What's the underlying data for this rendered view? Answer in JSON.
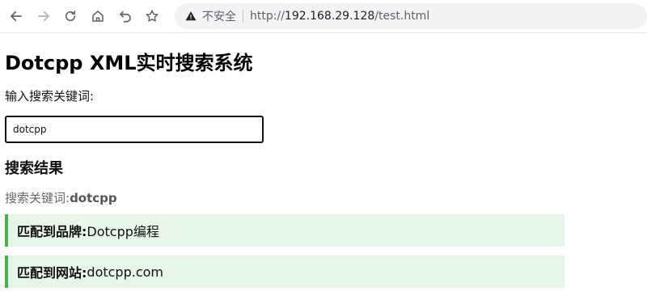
{
  "browser": {
    "security_text": "不安全",
    "url_scheme": "http://",
    "url_host": "192.168.29.128",
    "url_path": "/test.html",
    "icons": [
      "back-icon",
      "forward-icon",
      "reload-icon",
      "home-icon",
      "undo-icon",
      "star-icon",
      "warning-icon"
    ]
  },
  "page": {
    "title": "Dotcpp XML实时搜索系统",
    "input_label": "输入搜索关键词:",
    "search_value": "dotcpp",
    "results_heading": "搜索结果",
    "keyword_label": "搜索关键词:",
    "keyword_value": "dotcpp",
    "results": [
      {
        "label": "匹配到品牌:",
        "value": "Dotcpp编程"
      },
      {
        "label": "匹配到网站:",
        "value": "dotcpp.com"
      }
    ]
  },
  "colors": {
    "result_bg": "#e8f5e9",
    "result_border": "#4caf50"
  }
}
